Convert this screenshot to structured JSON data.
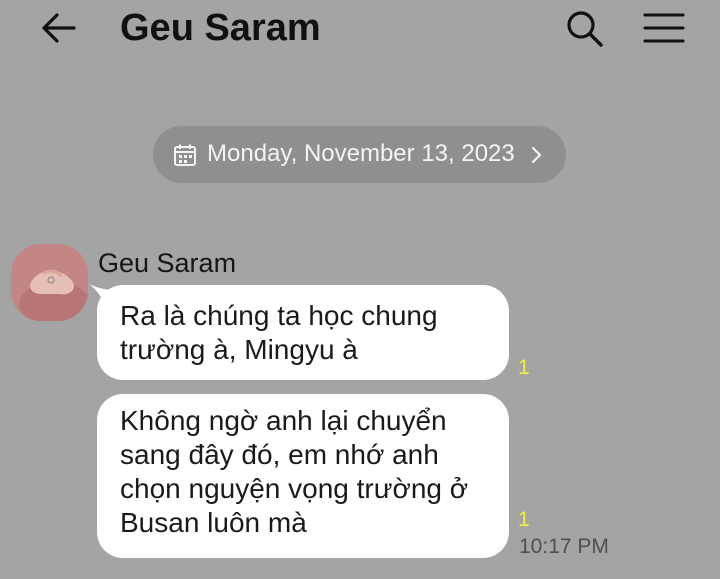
{
  "header": {
    "title": "Geu Saram",
    "back_icon": "arrow-left-icon",
    "search_icon": "search-icon",
    "menu_icon": "hamburger-menu-icon"
  },
  "date_divider": {
    "text": "Monday, November 13, 2023",
    "icon": "calendar-icon",
    "chevron": "chevron-right-icon"
  },
  "chat": {
    "sender_name": "Geu Saram",
    "messages": [
      {
        "text": "Ra là chúng ta học chung\ntrường à, Mingyu à",
        "unread": "1"
      },
      {
        "text": "Không ngờ anh lại chuyển\nsang đây đó, em nhớ anh\nchọn nguyện vọng trường ở\nBusan luôn mà",
        "unread": "1",
        "time": "10:17 PM"
      }
    ]
  },
  "colors": {
    "background": "#a4a4a4",
    "date_pill": "#8f8f8f",
    "bubble": "#ffffff",
    "unread": "#f2ec43"
  }
}
